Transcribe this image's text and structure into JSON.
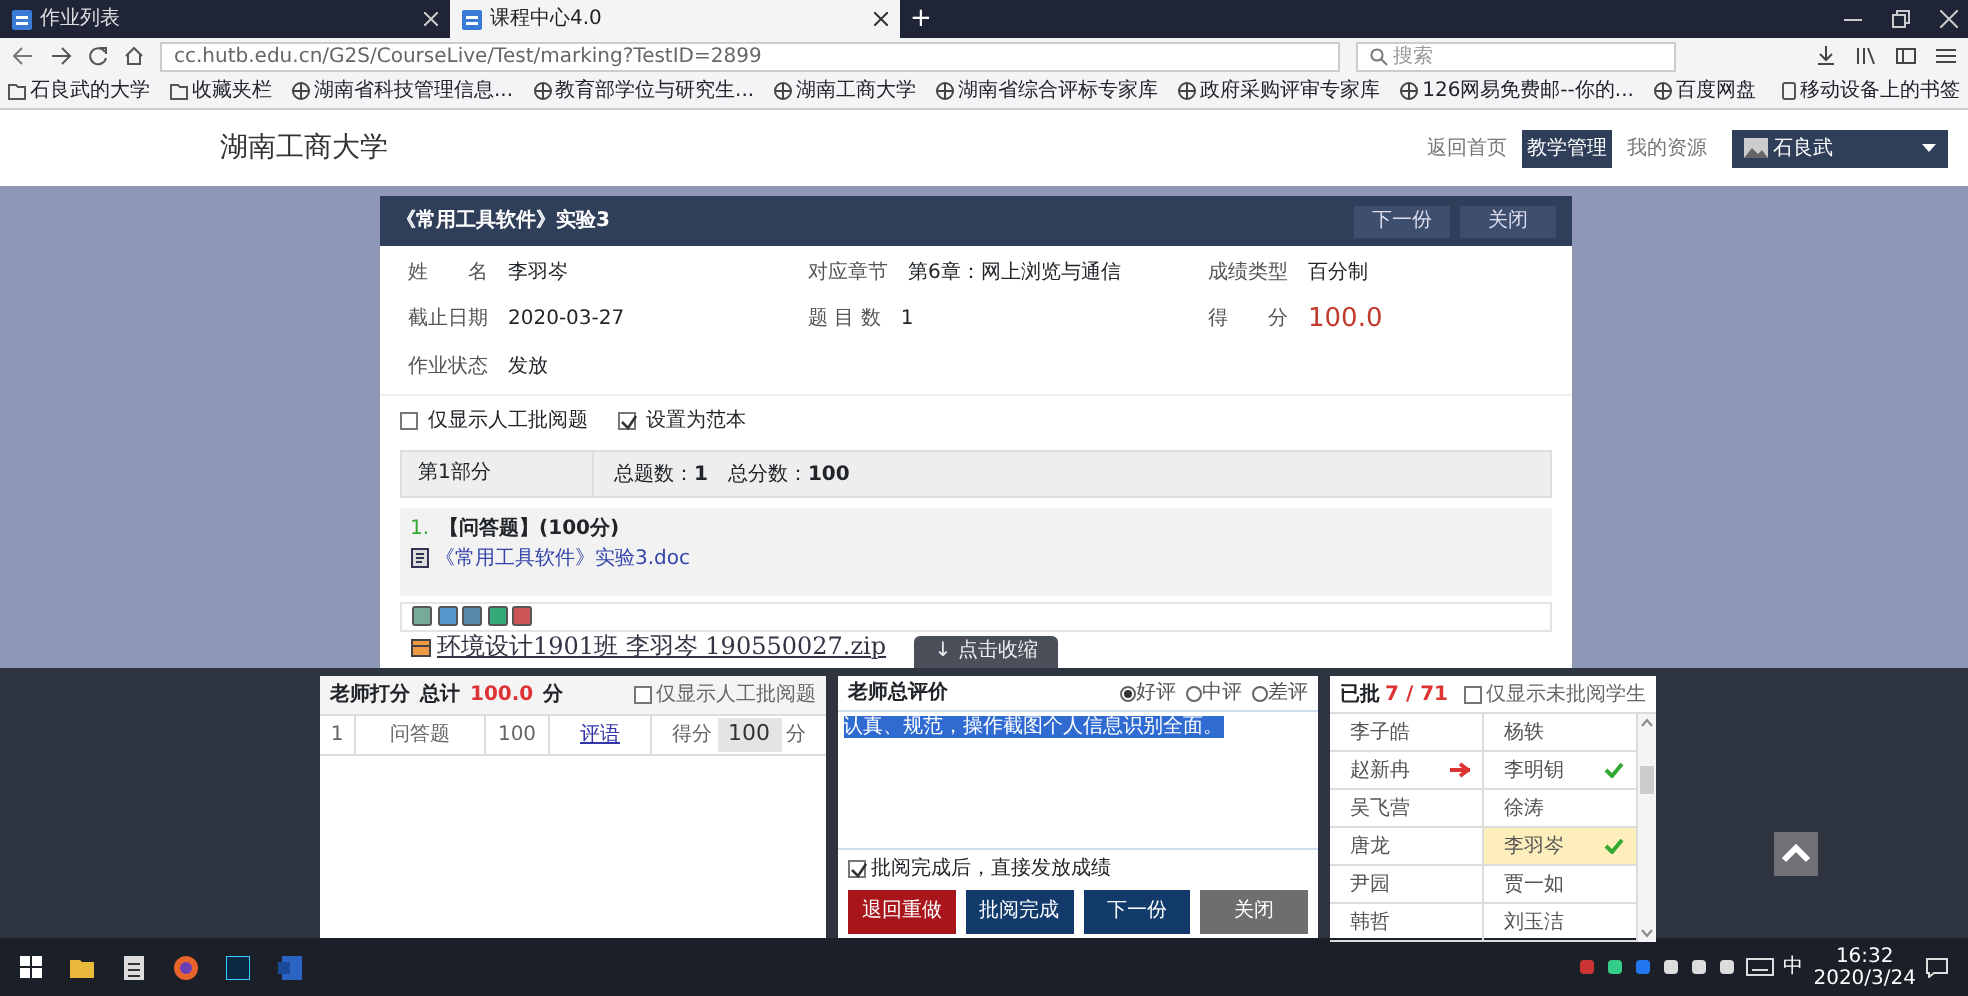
{
  "browser": {
    "tabs": [
      {
        "title": "作业列表",
        "selected": false
      },
      {
        "title": "课程中心4.0",
        "selected": true
      }
    ],
    "new_tab": "+",
    "url": "cc.hutb.edu.cn/G2S/CourseLive/Test/marking?TestID=2899",
    "search": {
      "placeholder": "搜索"
    },
    "bookmarks": [
      "石良武的大学",
      "收藏夹栏",
      "湖南省科技管理信息...",
      "教育部学位与研究生...",
      "湖南工商大学",
      "湖南省综合评标专家库",
      "政府采购评审专家库",
      "126网易免费邮--你的...",
      "百度网盘"
    ],
    "mobile_bookmarks": "移动设备上的书签"
  },
  "site": {
    "logo": "湖南工商大学",
    "nav": [
      {
        "label": "返回首页",
        "selected": false
      },
      {
        "label": "教学管理",
        "selected": true
      },
      {
        "label": "我的资源",
        "selected": false
      }
    ],
    "user": "石良武"
  },
  "dialog": {
    "title": "《常用工具软件》实验3",
    "buttons": [
      "下一份",
      "关闭"
    ],
    "info": [
      {
        "label": "姓　　名",
        "value": "李羽岑",
        "kind": "plain"
      },
      {
        "label": "对应章节",
        "value": "第6章：网上浏览与通信",
        "kind": "plain"
      },
      {
        "label": "成绩类型",
        "value": "百分制",
        "kind": "plain"
      },
      {
        "label": "截止日期",
        "value": "2020-03-27",
        "kind": "plain"
      },
      {
        "label": "题 目 数",
        "value": "1",
        "kind": "plain"
      },
      {
        "label": "得　　分",
        "value": "100.0",
        "kind": "score"
      },
      {
        "label": "作业状态",
        "value": "发放",
        "kind": "plain"
      }
    ],
    "filters": [
      {
        "label": "仅显示人工批阅题",
        "checked": false
      },
      {
        "label": "设置为范本",
        "checked": true
      }
    ],
    "part": {
      "name": "第1部分",
      "summary": "总题数：**1**　总分数：**100**"
    },
    "question": {
      "number": "1.",
      "type": "【问答题】(100分)",
      "attachment": "《常用工具软件》实验3.doc"
    },
    "answer_file": "环境设计1901班 李羽岑 190550027.zip",
    "collapse_tab": "↓ 点击收缩"
  },
  "scoring": {
    "title": "老师打分",
    "total_label": "总计",
    "total": "100.0",
    "unit": "分",
    "filter": {
      "label": "仅显示人工批阅题",
      "checked": false
    },
    "rows": [
      {
        "number": "1",
        "type": "问答题",
        "points": "100",
        "comment_link": "评语",
        "score_label": "得分",
        "score": "100",
        "unit": "分"
      }
    ]
  },
  "review": {
    "title": "老师总评价",
    "ratings": [
      {
        "label": "好评",
        "selected": true
      },
      {
        "label": "中评",
        "selected": false
      },
      {
        "label": "差评",
        "selected": false
      }
    ],
    "comment": "认真、规范，操作截图个人信息识别全面。",
    "publish": {
      "label": "批阅完成后，直接发放成绩",
      "checked": true
    },
    "buttons": [
      {
        "label": "退回重做",
        "kind": "danger"
      },
      {
        "label": "批阅完成",
        "kind": "primary"
      },
      {
        "label": "下一份",
        "kind": "primary"
      },
      {
        "label": "关闭",
        "kind": "secondary"
      }
    ]
  },
  "students": {
    "graded_label": "已批",
    "graded": "7 / 71",
    "filter": {
      "label": "仅显示未批阅学生",
      "checked": false
    },
    "list": [
      {
        "name": "李子皓",
        "graded": false,
        "returned": false,
        "selected": false
      },
      {
        "name": "杨轶",
        "graded": false,
        "returned": false,
        "selected": false
      },
      {
        "name": "赵新冉",
        "graded": false,
        "returned": true,
        "selected": false
      },
      {
        "name": "李明钥",
        "graded": true,
        "returned": false,
        "selected": false
      },
      {
        "name": "吴飞营",
        "graded": false,
        "returned": false,
        "selected": false
      },
      {
        "name": "徐涛",
        "graded": false,
        "returned": false,
        "selected": false
      },
      {
        "name": "唐龙",
        "graded": false,
        "returned": false,
        "selected": false
      },
      {
        "name": "李羽岑",
        "graded": true,
        "returned": false,
        "selected": true
      },
      {
        "name": "尹园",
        "graded": false,
        "returned": false,
        "selected": false
      },
      {
        "name": "贾一如",
        "graded": false,
        "returned": false,
        "selected": false
      },
      {
        "name": "韩哲",
        "graded": false,
        "returned": false,
        "selected": false
      },
      {
        "name": "刘玉洁",
        "graded": false,
        "returned": false,
        "selected": false
      }
    ]
  },
  "taskbar": {
    "ime": "中",
    "time": "16:32",
    "date": "2020/3/24"
  }
}
